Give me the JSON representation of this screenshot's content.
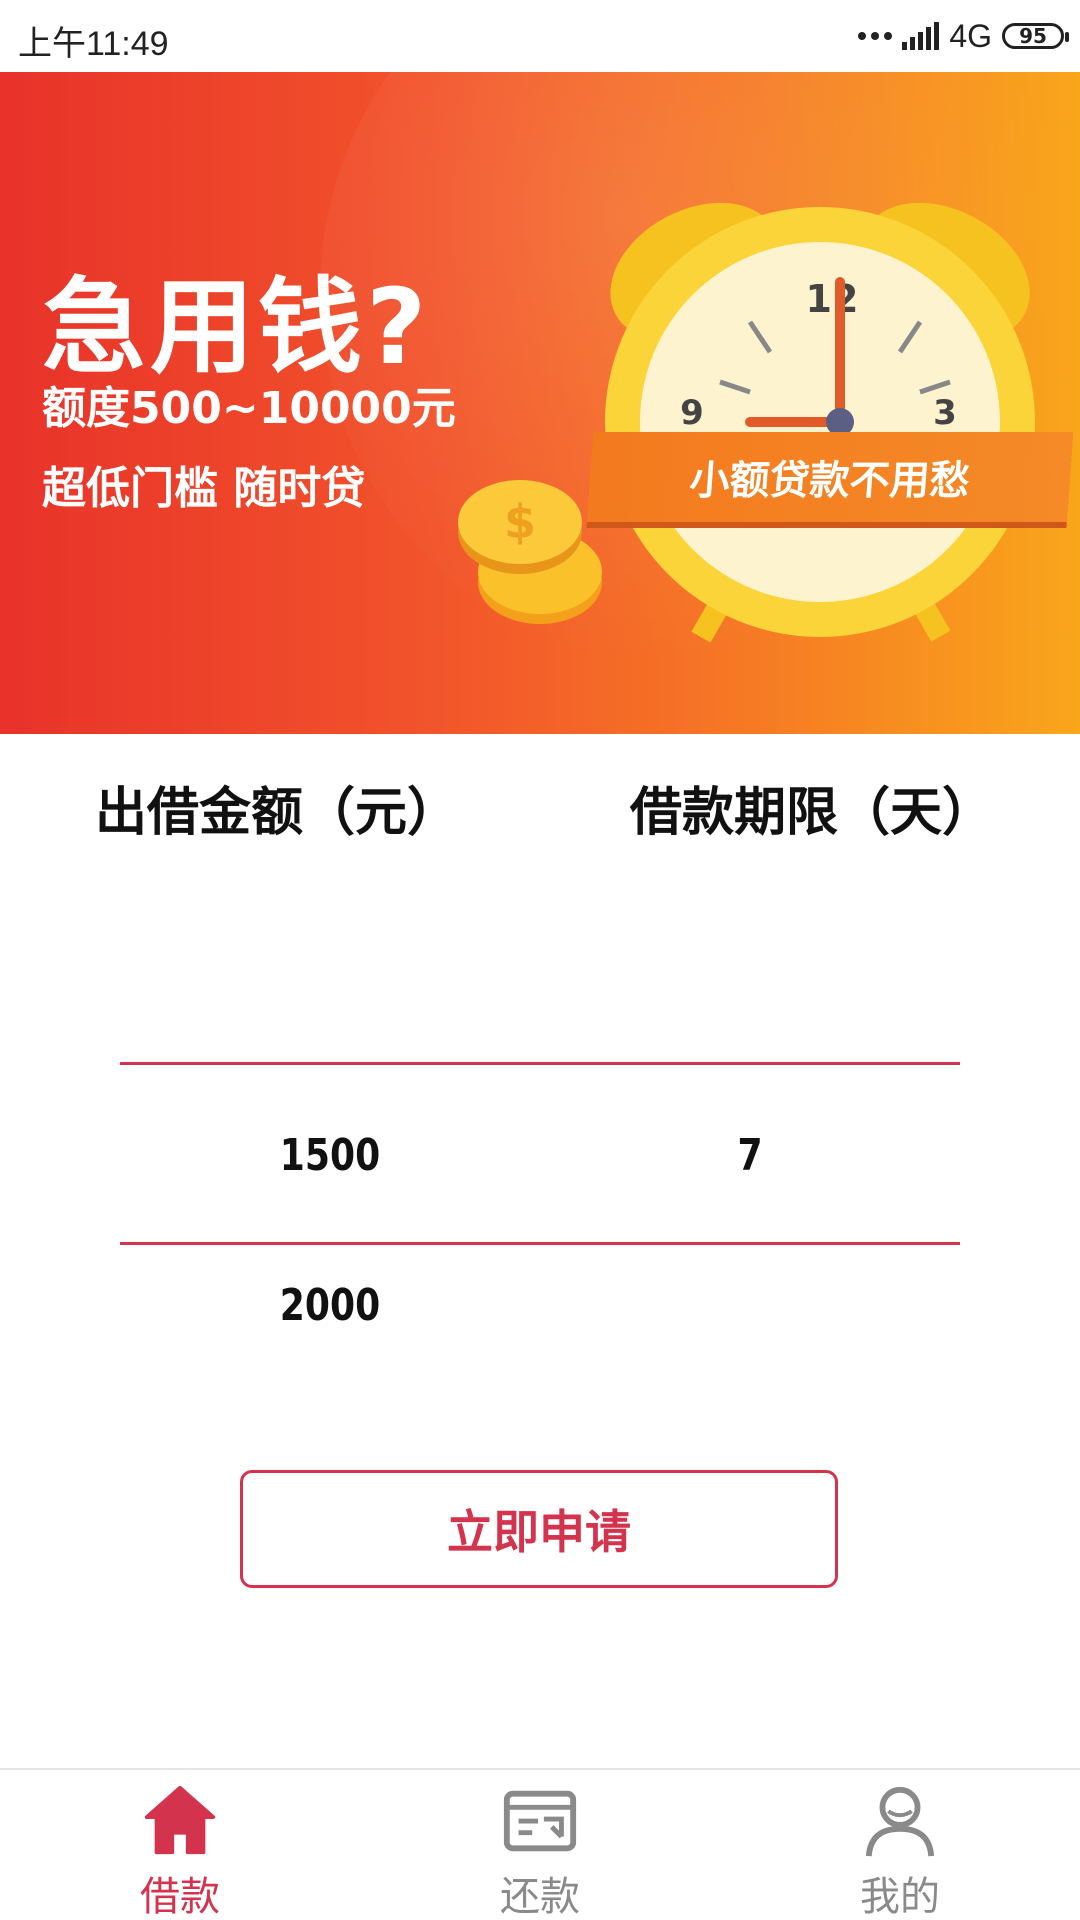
{
  "status_bar": {
    "time": "上午11:49",
    "network": "4G",
    "battery": "95"
  },
  "banner": {
    "title": "急用钱?",
    "subtitle_line1": "额度500~10000元",
    "subtitle_line2": "超低门槛 随时贷",
    "ribbon": "小额贷款不用愁",
    "clock_numbers": [
      "12",
      "3",
      "9"
    ]
  },
  "headers": {
    "amount": "出借金额（元）",
    "term": "借款期限（天）"
  },
  "picker": {
    "amount_selected": "1500",
    "amount_next": "2000",
    "term_selected": "7"
  },
  "apply_button": "立即申请",
  "nav": {
    "items": [
      {
        "label": "借款",
        "icon": "home-icon",
        "active": true
      },
      {
        "label": "还款",
        "icon": "repay-icon",
        "active": false
      },
      {
        "label": "我的",
        "icon": "user-icon",
        "active": false
      }
    ]
  },
  "colors": {
    "accent": "#d4334e",
    "inactive": "#8a8a8a"
  }
}
